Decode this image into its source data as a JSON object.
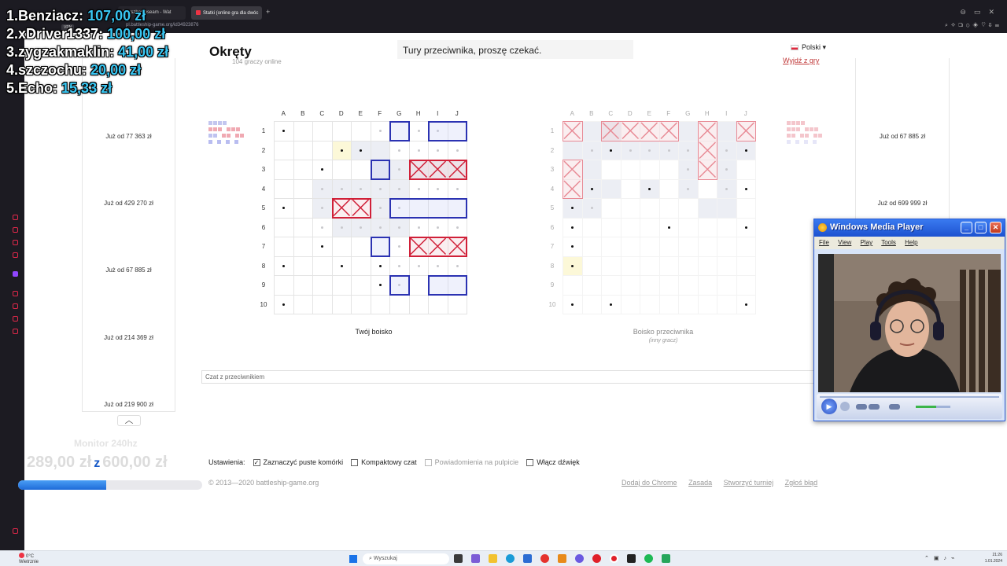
{
  "browser": {
    "tab1_title": "Marszbanieseam - Wat",
    "tab2_title": "Statki (online gra dla dwóc",
    "vpn_label": "VPN",
    "url": "pl.battleship-game.org/id34923876"
  },
  "overlay": {
    "leaderboard": [
      {
        "rank_name": "1.Benziacz:",
        "amount": "107,00 zł"
      },
      {
        "rank_name": "2.xDriver1337:",
        "amount": "100,00 zł"
      },
      {
        "rank_name": "3.zygzakmaklin:",
        "amount": "41,00 zł"
      },
      {
        "rank_name": "4.szczochu:",
        "amount": "20,00 zł"
      },
      {
        "rank_name": "5.Echo:",
        "amount": "15,33 zł"
      }
    ],
    "monitor_label": "Monitor 240hz",
    "goal_current": "289,00 zł",
    "goal_separator": "z",
    "goal_target": "600,00 zł",
    "goal_progress": 0.48
  },
  "ads": {
    "left": [
      "Już od 77 363 zł",
      "Już od 429 270 zł",
      "Już od 67 885 zł",
      "Już od 214 369 zł",
      "Już od 219 900 zł"
    ],
    "right": [
      "Już od 67 885 zł",
      "Już od 699 999 zł"
    ],
    "collapse_arrow": "︿"
  },
  "game": {
    "title": "Okręty",
    "online_count": "104 graczy online",
    "turn_status": "Tury przeciwnika, proszę czekać.",
    "language": "Polski ▾",
    "leave_link": "Wyjdź z gry",
    "columns": [
      "A",
      "B",
      "C",
      "D",
      "E",
      "F",
      "G",
      "H",
      "I",
      "J"
    ],
    "rows": [
      "1",
      "2",
      "3",
      "4",
      "5",
      "6",
      "7",
      "8",
      "9",
      "10"
    ],
    "my_board_caption": "Twój boisko",
    "enemy_board_caption": "Boisko przeciwnika",
    "enemy_board_subcaption": "(inny gracz)",
    "chat_placeholder": "Czat z przeciwnikiem"
  },
  "settings": {
    "label": "Ustawienia:",
    "options": [
      {
        "label": "Zaznaczyć puste komórki",
        "checked": true,
        "disabled": false
      },
      {
        "label": "Kompaktowy czat",
        "checked": false,
        "disabled": false
      },
      {
        "label": "Powiadomienia na pulpicie",
        "checked": false,
        "disabled": true
      },
      {
        "label": "Włącz dźwięk",
        "checked": false,
        "disabled": false
      }
    ]
  },
  "footer": {
    "copyright": "© 2013—2020 battleship-game.org",
    "links": [
      "Dodaj do Chrome",
      "Zasada",
      "Stworzyć turniej",
      "Zgłoś błąd"
    ]
  },
  "wmp": {
    "title": "Windows Media Player",
    "menu": [
      "File",
      "View",
      "Play",
      "Tools",
      "Help"
    ]
  },
  "taskbar": {
    "weather_temp": "0°C",
    "weather_desc": "Wietrznie",
    "search_placeholder": "Wyszukaj",
    "time": "21:26",
    "date": "1.01.2024"
  },
  "colors": {
    "my_ship": "#2b32b2",
    "hit": "#d02038",
    "leader_amount": "#39c6f2",
    "goal_fill": "#1e6bd8"
  }
}
